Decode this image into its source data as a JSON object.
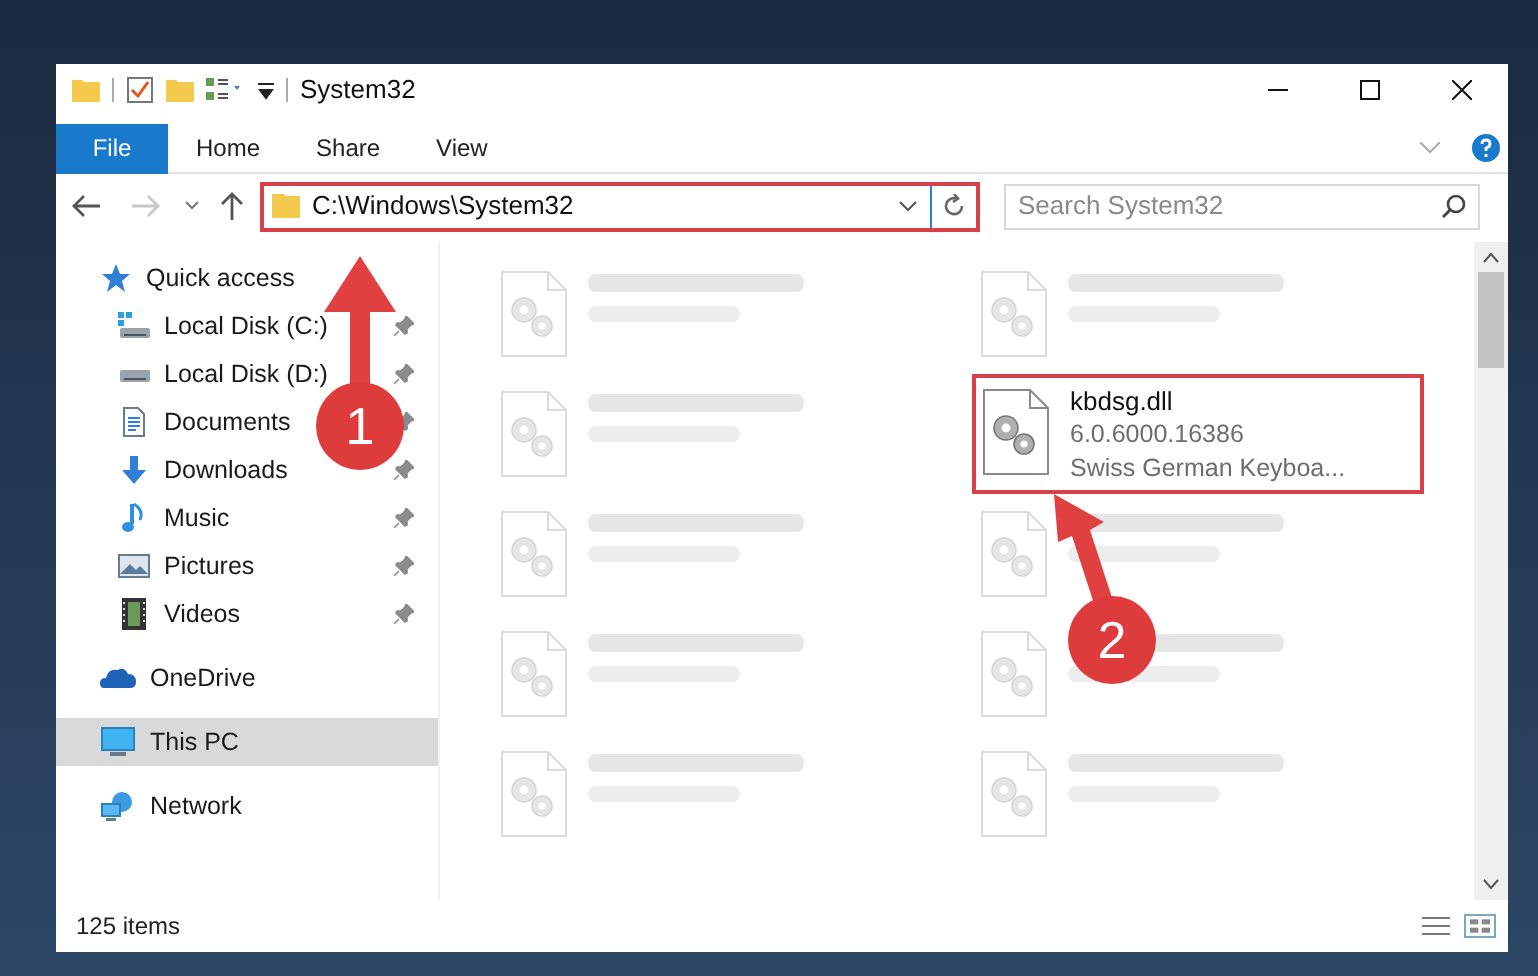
{
  "window": {
    "title": "System32"
  },
  "ribbon": {
    "tabs": [
      {
        "label": "File",
        "kind": "file",
        "selected": false
      },
      {
        "label": "Home",
        "kind": "tab",
        "selected": false
      },
      {
        "label": "Share",
        "kind": "tab",
        "selected": false
      },
      {
        "label": "View",
        "kind": "tab",
        "selected": false
      }
    ]
  },
  "address": {
    "path": "C:\\Windows\\System32",
    "highlighted": true
  },
  "search": {
    "placeholder": "Search System32"
  },
  "sidebar": {
    "items": [
      {
        "label": "Quick access",
        "kind": "star",
        "selected": false,
        "children": [
          {
            "label": "Local Disk (C:)",
            "kind": "system-drive",
            "pinned": true,
            "selected": false
          },
          {
            "label": "Local Disk (D:)",
            "kind": "drive",
            "pinned": true,
            "selected": false
          },
          {
            "label": "Documents",
            "kind": "documents",
            "pinned": true,
            "selected": false
          },
          {
            "label": "Downloads",
            "kind": "downloads",
            "pinned": true,
            "selected": false
          },
          {
            "label": "Music",
            "kind": "music",
            "pinned": true,
            "selected": false
          },
          {
            "label": "Pictures",
            "kind": "pictures",
            "pinned": true,
            "selected": false
          },
          {
            "label": "Videos",
            "kind": "videos",
            "pinned": true,
            "selected": false
          }
        ]
      },
      {
        "label": "OneDrive",
        "kind": "cloud",
        "selected": false
      },
      {
        "label": "This PC",
        "kind": "computer",
        "selected": true
      },
      {
        "label": "Network",
        "kind": "network",
        "selected": false
      }
    ]
  },
  "files": [
    {
      "kind": "blurred"
    },
    {
      "kind": "blurred"
    },
    {
      "kind": "blurred"
    },
    {
      "kind": "file",
      "name": "kbdsg.dll",
      "details": [
        "6.0.6000.16386",
        "Swiss German Keyboa..."
      ],
      "highlighted": true
    },
    {
      "kind": "blurred"
    },
    {
      "kind": "blurred"
    },
    {
      "kind": "blurred"
    },
    {
      "kind": "blurred"
    },
    {
      "kind": "blurred"
    },
    {
      "kind": "blurred"
    }
  ],
  "status_bar": {
    "count": "125 items"
  },
  "annotations": [
    {
      "number": "1",
      "kind": "up"
    },
    {
      "number": "2",
      "kind": "up-left"
    }
  ]
}
